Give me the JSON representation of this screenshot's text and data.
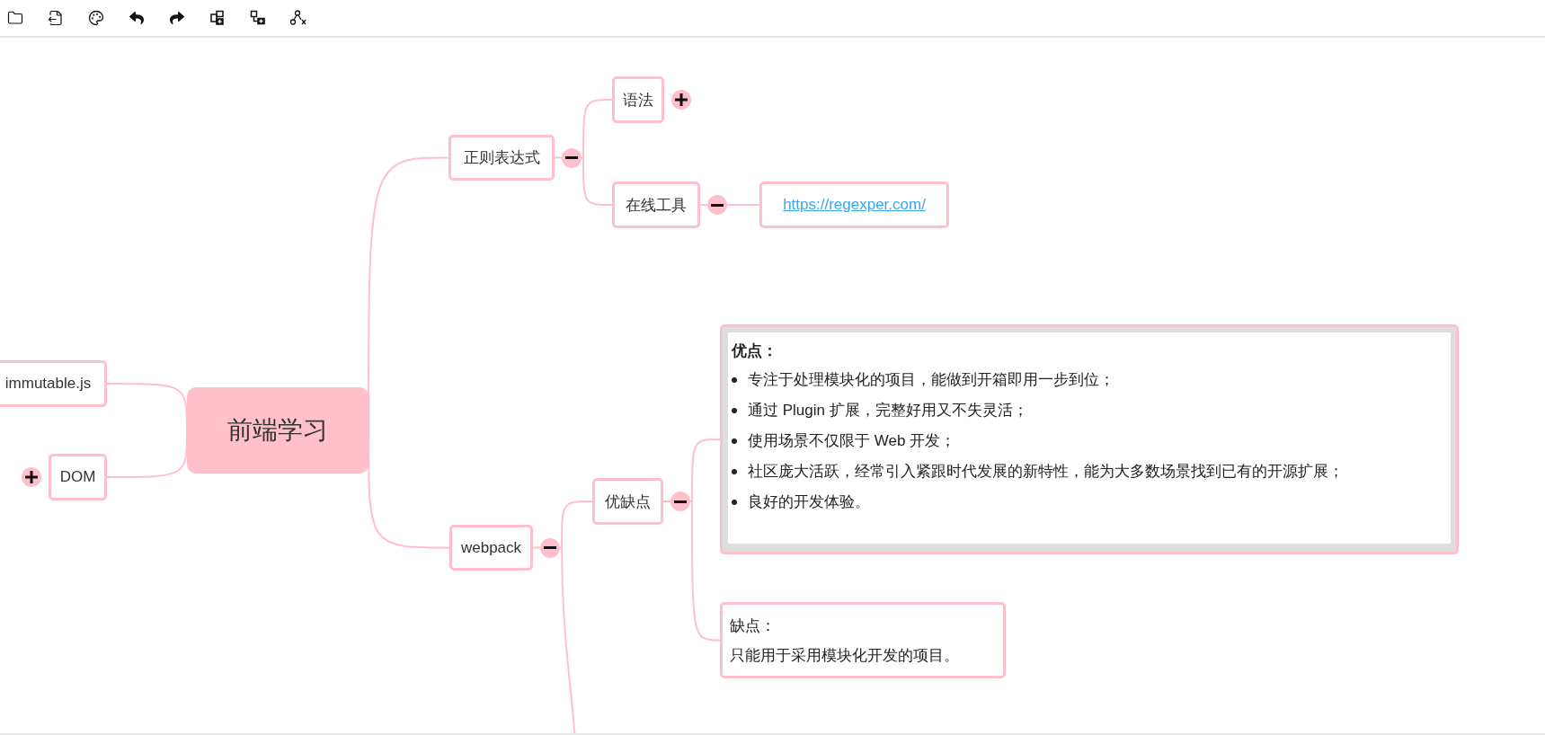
{
  "mindmap": {
    "root": {
      "label": "前端学习",
      "right": [
        {
          "label": "正则表达式",
          "expanded": true,
          "children": [
            {
              "label": "语法",
              "expanded": false
            },
            {
              "label": "在线工具",
              "expanded": true,
              "children": [
                {
                  "kind": "link",
                  "label": "https://regexper.com/"
                }
              ]
            }
          ]
        },
        {
          "label": "webpack",
          "expanded": true,
          "children": [
            {
              "label": "优缺点",
              "expanded": true,
              "children": [
                {
                  "kind": "note",
                  "title": "优点：",
                  "items": [
                    "专注于处理模块化的项目，能做到开箱即用一步到位；",
                    "通过 Plugin 扩展，完整好用又不失灵活；",
                    "使用场景不仅限于 Web 开发；",
                    "社区庞大活跃，经常引入紧跟时代发展的新特性，能为大多数场景找到已有的开源扩展；",
                    "良好的开发体验。"
                  ]
                },
                {
                  "kind": "text",
                  "lines": [
                    "缺点：",
                    "只能用于采用模块化开发的项目。"
                  ]
                }
              ]
            }
          ]
        }
      ],
      "left": [
        {
          "label": "immutable.js"
        },
        {
          "label": "DOM",
          "expanded": false
        }
      ]
    }
  }
}
